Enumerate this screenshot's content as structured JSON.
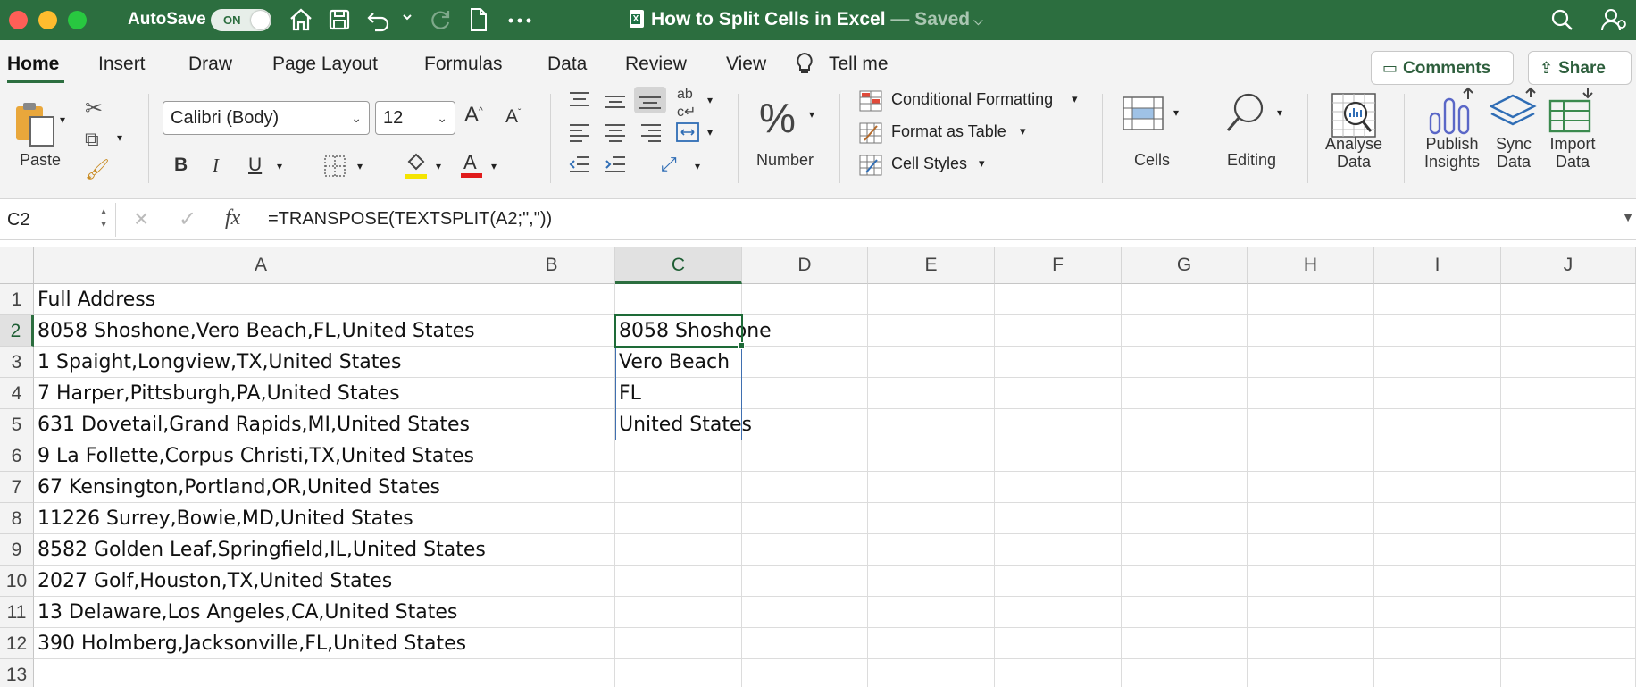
{
  "titlebar": {
    "autosave_label": "AutoSave",
    "autosave_toggle": "ON",
    "title": "How to Split Cells in Excel",
    "saved": " — Saved"
  },
  "tabs": {
    "items": [
      "Home",
      "Insert",
      "Draw",
      "Page Layout",
      "Formulas",
      "Data",
      "Review",
      "View"
    ],
    "active": "Home",
    "tell_me": "Tell me",
    "comments": "Comments",
    "share": "Share"
  },
  "ribbon": {
    "paste": "Paste",
    "font_name": "Calibri (Body)",
    "font_size": "12",
    "number": "Number",
    "conditional_formatting": "Conditional Formatting",
    "format_as_table": "Format as Table",
    "cell_styles": "Cell Styles",
    "cells": "Cells",
    "editing": "Editing",
    "analyse_data_1": "Analyse",
    "analyse_data_2": "Data",
    "publish_insights_1": "Publish",
    "publish_insights_2": "Insights",
    "sync_data_1": "Sync",
    "sync_data_2": "Data",
    "import_data_1": "Import",
    "import_data_2": "Data"
  },
  "formula_bar": {
    "name_box": "C2",
    "formula": "=TRANSPOSE(TEXTSPLIT(A2;\",\"))"
  },
  "sheet": {
    "columns": [
      "A",
      "B",
      "C",
      "D",
      "E",
      "F",
      "G",
      "H",
      "I",
      "J"
    ],
    "rows": [
      "1",
      "2",
      "3",
      "4",
      "5",
      "6",
      "7",
      "8",
      "9",
      "10",
      "11",
      "12",
      "13"
    ],
    "col_a": [
      "Full Address",
      "8058 Shoshone,Vero Beach,FL,United States",
      "1 Spaight,Longview,TX,United States",
      "7 Harper,Pittsburgh,PA,United States",
      "631 Dovetail,Grand Rapids,MI,United States",
      "9 La Follette,Corpus Christi,TX,United States",
      "67 Kensington,Portland,OR,United States",
      "11226 Surrey,Bowie,MD,United States",
      "8582 Golden Leaf,Springfield,IL,United States",
      "2027 Golf,Houston,TX,United States",
      "13 Delaware,Los Angeles,CA,United States",
      "390 Holmberg,Jacksonville,FL,United States"
    ],
    "col_c": [
      "8058 Shoshone",
      "Vero Beach",
      "FL",
      "United States"
    ]
  }
}
